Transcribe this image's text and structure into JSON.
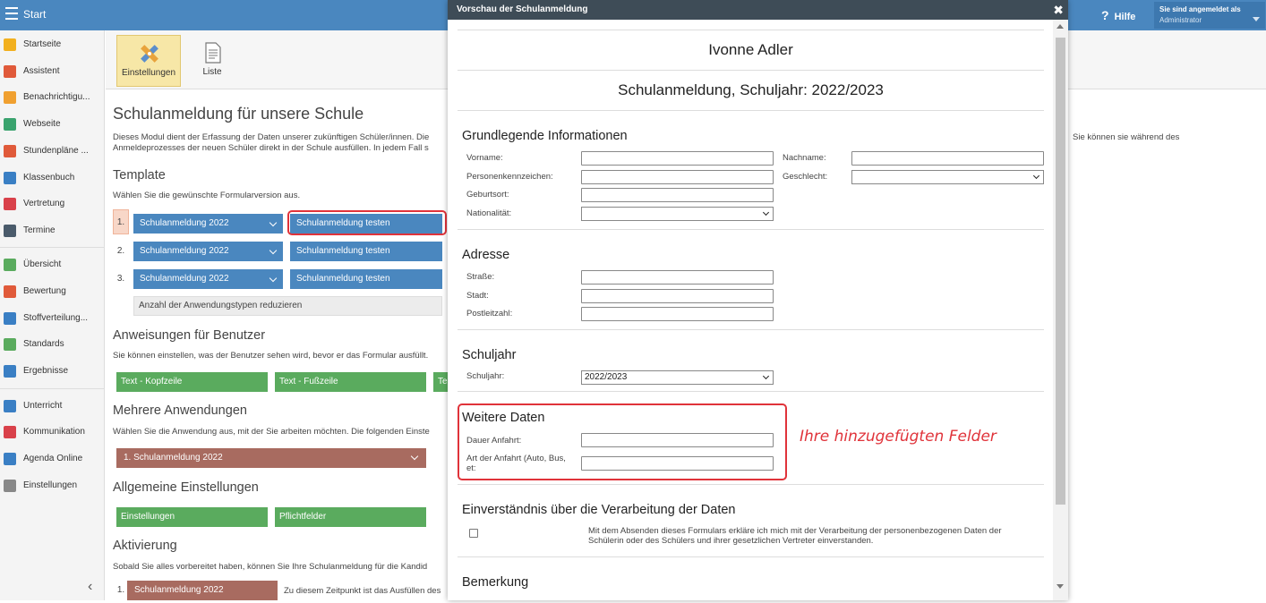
{
  "topbar": {
    "start_label": "Start",
    "help_label": "Hilfe",
    "user_line1": "Sie sind angemeldet als",
    "user_line2": "Administrator"
  },
  "sidebar": {
    "items": [
      {
        "label": "Startseite",
        "icon": "star-icon",
        "color": "#f2b01e"
      },
      {
        "label": "Assistent",
        "icon": "wand-icon",
        "color": "#e05a3a"
      },
      {
        "label": "Benachrichtigu...",
        "icon": "envelope-icon",
        "color": "#f0a030"
      },
      {
        "label": "Webseite",
        "icon": "house-icon",
        "color": "#3aa36e"
      },
      {
        "label": "Stundenpläne ...",
        "icon": "grid-icon",
        "color": "#e05a3a"
      },
      {
        "label": "Klassenbuch",
        "icon": "book-icon",
        "color": "#3a7fc4"
      },
      {
        "label": "Vertretung",
        "icon": "person-icon",
        "color": "#d9414a"
      },
      {
        "label": "Termine",
        "icon": "calendar-icon",
        "color": "#4a5b6b"
      },
      {
        "label": "Übersicht",
        "icon": "check-circle-icon",
        "color": "#5aab5e"
      },
      {
        "label": "Bewertung",
        "icon": "rating-icon",
        "color": "#e05a3a"
      },
      {
        "label": "Stoffverteilung...",
        "icon": "briefcase-icon",
        "color": "#3a7fc4"
      },
      {
        "label": "Standards",
        "icon": "shield-icon",
        "color": "#5aab5e"
      },
      {
        "label": "Ergebnisse",
        "icon": "barchart-icon",
        "color": "#3a7fc4"
      },
      {
        "label": "Unterricht",
        "icon": "briefcase-icon",
        "color": "#3a7fc4"
      },
      {
        "label": "Kommunikation",
        "icon": "chat-icon",
        "color": "#d9414a"
      },
      {
        "label": "Agenda Online",
        "icon": "pen-icon",
        "color": "#3a7fc4"
      },
      {
        "label": "Einstellungen",
        "icon": "gear-icon",
        "color": "#888888"
      }
    ]
  },
  "toolbar": {
    "settings_label": "Einstellungen",
    "list_label": "Liste"
  },
  "main": {
    "title": "Schulanmeldung für unsere Schule",
    "desc_line1": "Dieses Modul dient der Erfassung der Daten unserer zukünftigen Schüler/innen. Die",
    "desc_line2": "Anmeldeprozesses der neuen Schüler direkt in der Schule ausfüllen. In jedem Fall s",
    "desc_right": "Sie können sie während des",
    "template_heading": "Template",
    "template_text": "Wählen Sie die gewünschte Formularversion aus.",
    "rows": [
      {
        "num": "1.",
        "select": "Schulanmeldung 2022",
        "test": "Schulanmeldung testen"
      },
      {
        "num": "2.",
        "select": "Schulanmeldung 2022",
        "test": "Schulanmeldung testen"
      },
      {
        "num": "3.",
        "select": "Schulanmeldung 2022",
        "test": "Schulanmeldung testen"
      }
    ],
    "reduce_label": "Anzahl der Anwendungstypen reduzieren",
    "instructions_heading": "Anweisungen für Benutzer",
    "instructions_text": "Sie können einstellen, was der Benutzer sehen wird, bevor er das Formular ausfüllt.",
    "header_btn": "Text - Kopfzeile",
    "footer_btn": "Text - Fußzeile",
    "third_btn": "Te",
    "multi_heading": "Mehrere Anwendungen",
    "multi_text": "Wählen Sie die Anwendung aus, mit der Sie arbeiten möchten. Die folgenden Einste",
    "multi_select": "1. Schulanmeldung 2022",
    "general_heading": "Allgemeine Einstellungen",
    "general_btn1": "Einstellungen",
    "general_btn2": "Pflichtfelder",
    "activation_heading": "Aktivierung",
    "activation_text": "Sobald Sie alles vorbereitet haben, können Sie Ihre Schulanmeldung für die Kandid",
    "activation_num": "1.",
    "activation_btn": "Schulanmeldung 2022",
    "activation_after": "Zu diesem Zeitpunkt ist das Ausfüllen des"
  },
  "modal": {
    "title": "Vorschau der Schulanmeldung",
    "close": "✖",
    "name": "Ivonne Adler",
    "subtitle": "Schulanmeldung, Schuljahr: 2022/2023",
    "basic_heading": "Grundlegende Informationen",
    "vorname": "Vorname:",
    "nachname": "Nachname:",
    "personenkennzeichen": "Personenkennzeichen:",
    "geschlecht": "Geschlecht:",
    "geburtsort": "Geburtsort:",
    "nationalitaet": "Nationalität:",
    "address_heading": "Adresse",
    "strasse": "Straße:",
    "stadt": "Stadt:",
    "plz": "Postleitzahl:",
    "year_heading": "Schuljahr",
    "schuljahr_label": "Schuljahr:",
    "schuljahr_value": "2022/2023",
    "more_heading": "Weitere Daten",
    "dauer": "Dauer Anfahrt:",
    "art_line1": "Art der Anfahrt (Auto, Bus,",
    "art_line2": "et:",
    "consent_heading": "Einverständnis über die Verarbeitung der Daten",
    "consent_line1": "Mit dem Absenden dieses Formulars erkläre ich mich mit der Verarbeitung der personenbezogenen Daten der",
    "consent_line2": "Schülerin oder des Schülers und ihrer gesetzlichen Vertreter einverstanden.",
    "remark_heading": "Bemerkung"
  },
  "annotation": "Ihre hinzugefügten Felder"
}
